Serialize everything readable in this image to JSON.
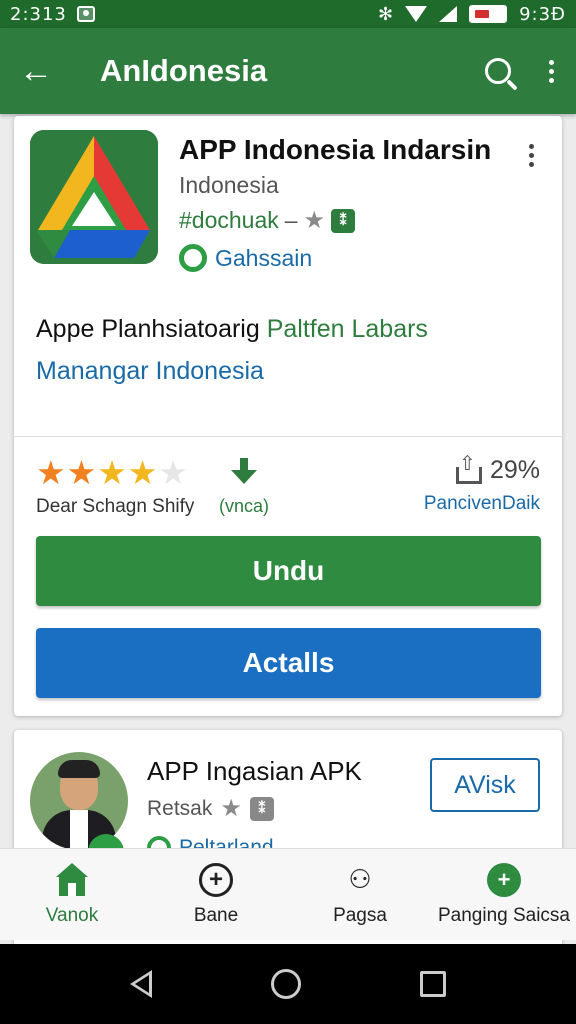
{
  "status_bar": {
    "time": "2:313",
    "clock_right": "9:3Đ",
    "icons": [
      "photo-icon",
      "bluetooth-icon",
      "wifi-icon",
      "signal-icon",
      "battery-icon"
    ]
  },
  "app_bar": {
    "title": "AnIdonesia",
    "icons": [
      "back-arrow-icon",
      "search-icon",
      "more-vert-icon"
    ]
  },
  "app_card": {
    "title": "APP Indonesia Indarsin",
    "subtitle": "Indonesia",
    "tag": "#dochuak",
    "tag_separator": "–",
    "developer": "Gahssain",
    "description": {
      "part1": "Appe Planhsiatoarig ",
      "part2": "Paltfen Labars",
      "part3": "Manangar Indonesia"
    },
    "rating": {
      "stars_filled": 4,
      "stars_total": 5,
      "caption": "Dear Schagn Shify"
    },
    "download": {
      "caption": "(vnca)"
    },
    "share": {
      "percent": "29%",
      "caption": "PancivenDaik"
    },
    "primary_button": "Undu",
    "secondary_button": "Actalls"
  },
  "second_card": {
    "title": "APP Ingasian APK",
    "subtitle": "Retsak",
    "developer": "Peltarland",
    "action_button": "AVisk"
  },
  "bottom_nav": {
    "items": [
      {
        "label": "Vanok",
        "icon": "home-icon",
        "active": true
      },
      {
        "label": "Bane",
        "icon": "plus-circle-icon",
        "active": false
      },
      {
        "label": "Pagsa",
        "icon": "people-icon",
        "active": false
      },
      {
        "label": "Panging Saicsa",
        "icon": "add-circle-icon",
        "active": false
      }
    ]
  },
  "system_nav": {
    "icons": [
      "back-triangle-icon",
      "home-circle-icon",
      "recents-square-icon"
    ]
  },
  "colors": {
    "status_bar": "#1e6b2c",
    "app_bar": "#2e7d3e",
    "primary_button": "#2e8b40",
    "secondary_button": "#1a6fc2",
    "link_blue": "#1a6aa8",
    "star_orange": "#f08020",
    "star_yellow": "#f2b61e"
  }
}
